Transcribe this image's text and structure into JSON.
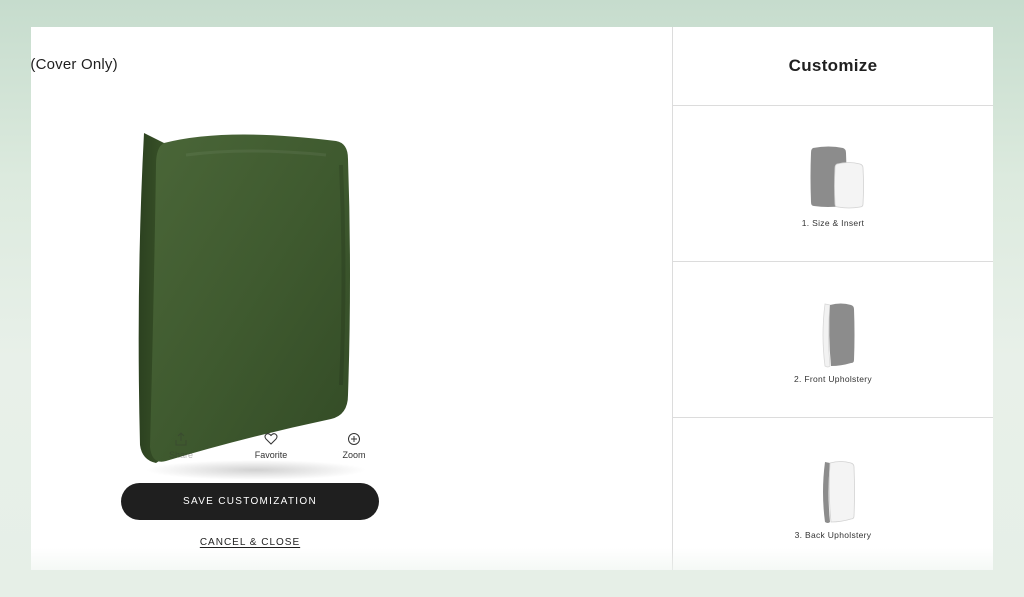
{
  "product": {
    "title_fragment": "w (Cover Only)",
    "image_alt": "Green square pillow"
  },
  "actions": {
    "share_label": "Share",
    "favorite_label": "Favorite",
    "zoom_label": "Zoom"
  },
  "buttons": {
    "save_label": "SAVE CUSTOMIZATION",
    "cancel_label": "CANCEL & CLOSE"
  },
  "customize": {
    "title": "Customize",
    "steps": [
      {
        "label": "1. Size & Insert"
      },
      {
        "label": "2. Front Upholstery"
      },
      {
        "label": "3. Back Upholstery"
      }
    ]
  },
  "colors": {
    "pillow_green": "#3f5a2f",
    "button_dark": "#1f1f1f",
    "thumb_gray": "#8c8c8c"
  },
  "icons": {
    "favorite": "heart-icon",
    "zoom": "zoom-plus-icon"
  }
}
